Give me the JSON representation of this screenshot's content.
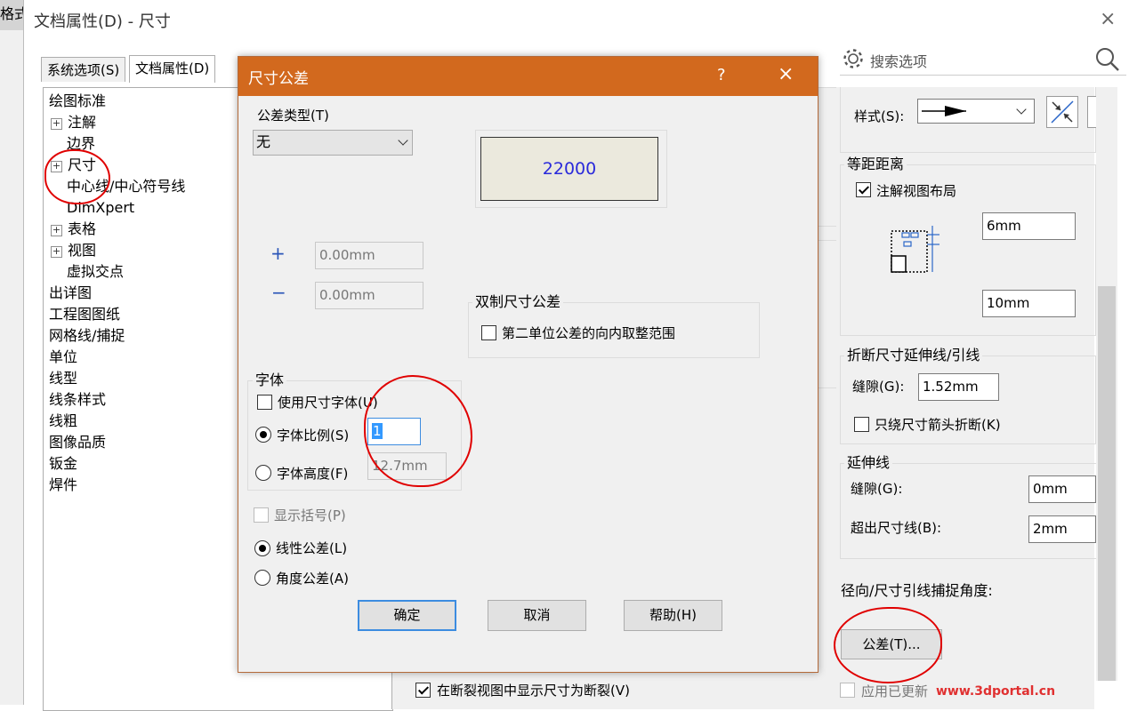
{
  "background": {
    "left_tab_text": "格式",
    "window_title": "文档属性(D) - 尺寸",
    "close_icon": "×",
    "tabs": [
      {
        "label": "系统选项(S)",
        "active": false
      },
      {
        "label": "文档属性(D)",
        "active": true
      }
    ],
    "search": {
      "label": "搜索选项",
      "icons": [
        "gear-icon",
        "search-icon"
      ]
    },
    "tree": [
      {
        "label": "绘图标准",
        "expander": false,
        "indent": 0
      },
      {
        "label": "注解",
        "expander": true,
        "indent": 1
      },
      {
        "label": "边界",
        "expander": false,
        "indent": 1
      },
      {
        "label": "尺寸",
        "expander": true,
        "indent": 1
      },
      {
        "label": "中心线/中心符号线",
        "expander": false,
        "indent": 1
      },
      {
        "label": "DimXpert",
        "expander": false,
        "indent": 1
      },
      {
        "label": "表格",
        "expander": true,
        "indent": 1
      },
      {
        "label": "视图",
        "expander": true,
        "indent": 1
      },
      {
        "label": "虚拟交点",
        "expander": false,
        "indent": 1
      },
      {
        "label": "出详图",
        "expander": false,
        "indent": 0
      },
      {
        "label": "工程图图纸",
        "expander": false,
        "indent": 0
      },
      {
        "label": "网格线/捕捉",
        "expander": false,
        "indent": 0
      },
      {
        "label": "单位",
        "expander": false,
        "indent": 0
      },
      {
        "label": "线型",
        "expander": false,
        "indent": 0
      },
      {
        "label": "线条样式",
        "expander": false,
        "indent": 0
      },
      {
        "label": "线粗",
        "expander": false,
        "indent": 0
      },
      {
        "label": "图像品质",
        "expander": false,
        "indent": 0
      },
      {
        "label": "钣金",
        "expander": false,
        "indent": 0
      },
      {
        "label": "焊件",
        "expander": false,
        "indent": 0
      }
    ],
    "right": {
      "style_label": "样式(S):",
      "offset_group": "等距距离",
      "annotate_layout": "注解视图布局",
      "annotate_layout_checked": true,
      "offset1": "6mm",
      "offset2": "10mm",
      "break_group": "折断尺寸延伸线/引线",
      "gap_label": "缝隙(G):",
      "gap_value": "1.52mm",
      "break_arrow_only": "只绕尺寸箭头折断(K)",
      "ext_group": "延伸线",
      "ext_gap_label": "缝隙(G):",
      "ext_gap_value": "0mm",
      "beyond_label": "超出尺寸线(B):",
      "beyond_value": "2mm",
      "snap_angle_label": "径向/尺寸引线捕捉角度:",
      "tolerance_button": "公差(T)...",
      "apply_updated": "应用已更新",
      "watermark": "www.3dportal.cn"
    },
    "bottom_checkbox": {
      "label": "在断裂视图中显示尺寸为断裂(V)",
      "checked": true
    }
  },
  "dialog": {
    "title": "尺寸公差",
    "help_icon": "?",
    "close_icon": "×",
    "tolerance_type_label": "公差类型(T)",
    "tolerance_type_value": "无",
    "preview_value": "22000",
    "plus_sign": "+",
    "minus_sign": "−",
    "upper_value": "0.00mm",
    "lower_value": "0.00mm",
    "dual_group": "双制尺寸公差",
    "dual_option": "第二单位公差的向内取整范围",
    "font_group": "字体",
    "use_dim_font": "使用尺寸字体(U)",
    "font_scale": "字体比例(S)",
    "font_scale_value": "1",
    "font_height": "字体高度(F)",
    "font_height_value": "12.7mm",
    "show_parentheses": "显示括号(P)",
    "linear_tol": "线性公差(L)",
    "angular_tol": "角度公差(A)",
    "ok": "确定",
    "cancel": "取消",
    "help": "帮助(H)"
  }
}
